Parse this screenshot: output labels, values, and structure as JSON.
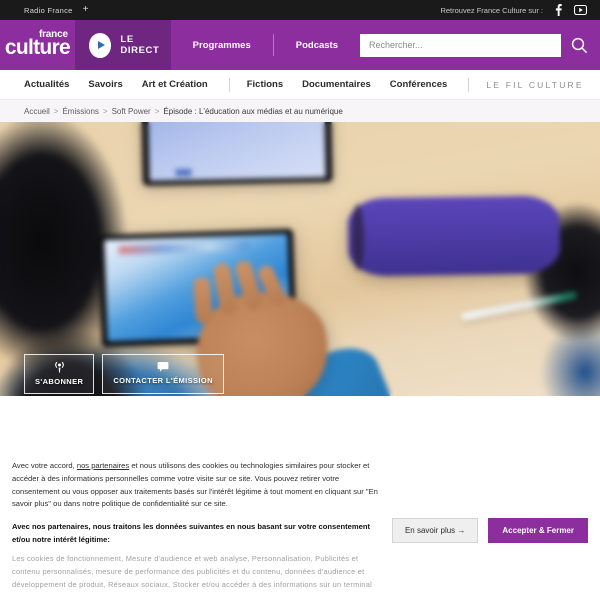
{
  "topbar": {
    "brand": "Radio France",
    "expand_icon": "+",
    "social_label": "Retrouvez France Culture sur :",
    "social": [
      {
        "name": "facebook-icon"
      },
      {
        "name": "youtube-icon"
      }
    ]
  },
  "header": {
    "logo_top": "france",
    "logo_bottom": "culture",
    "direct_label": "LE DIRECT",
    "nav": [
      {
        "label": "Programmes"
      },
      {
        "label": "Podcasts"
      }
    ],
    "search_placeholder": "Rechercher...",
    "search_value": "",
    "colors": {
      "purple": "#8C2E9E",
      "purple_dark": "#6E2680"
    }
  },
  "subnav": {
    "items": [
      {
        "label": "Actualités"
      },
      {
        "label": "Savoirs"
      },
      {
        "label": "Art et Création"
      },
      {
        "label": "Fictions"
      },
      {
        "label": "Documentaires"
      },
      {
        "label": "Conférences"
      }
    ],
    "fil": "LE FIL CULTURE"
  },
  "breadcrumb": {
    "items": [
      {
        "label": "Accueil"
      },
      {
        "label": "Émissions"
      },
      {
        "label": "Soft Power"
      },
      {
        "label": "Épisode : L'éducation aux médias et au numérique"
      }
    ],
    "separator": ">"
  },
  "hero": {
    "alt": "Des enfants utilisant des tablettes numériques en classe",
    "actions": [
      {
        "label": "S'ABONNER",
        "icon": "podcast-icon"
      },
      {
        "label": "CONTACTER L'ÉMISSION",
        "icon": "speech-bubble-icon"
      }
    ]
  },
  "cookie": {
    "paragraph1_a": "Avec votre accord, ",
    "paragraph1_link": "nos partenaires",
    "paragraph1_b": " et nous utilisons des cookies ou technologies similaires pour stocker et accéder à des informations personnelles comme votre visite sur ce site. Vous pouvez retirer votre consentement ou vous opposer aux traitements basés sur l'intérêt légitime à tout moment en cliquant sur \"En savoir plus\" ou dans notre politique de confidentialité sur ce site.",
    "heading": "Avec nos partenaires, nous traitons les données suivantes en nous basant sur votre consentement et/ou notre intérêt légitime:",
    "purposes": "Les cookies de fonctionnement, Mesure d'audience et web analyse, Personnalisation, Publicités et contenu personnalisés, mesure de performance des publicités et du contenu, données d'audience et développement de produit, Réseaux sociaux, Stocker et/ou accéder à des informations sur un terminal",
    "learn_more_label": "En savoir plus  →",
    "accept_label": "Accepter & Fermer",
    "accent_color": "#8C2E9E"
  }
}
